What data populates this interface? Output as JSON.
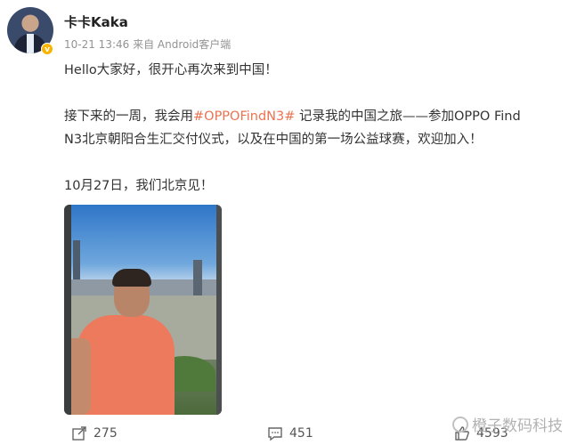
{
  "user": {
    "name": "卡卡Kaka",
    "verified_badge": "v",
    "timestamp": "10-21 13:46",
    "source": "来自 Android客户端"
  },
  "post": {
    "line1": "Hello大家好，很开心再次来到中国！",
    "line2_pre": "接下来的一周，我会用",
    "hashtag": "#OPPOFindN3#",
    "line2_post": " 记录我的中国之旅——参加OPPO Find",
    "line3": "N3北京朝阳合生汇交付仪式，以及在中国的第一场公益球赛，欢迎加入！",
    "line4": "10月27日，我们北京见！"
  },
  "colors": {
    "hashtag": "#eb7350",
    "meta": "#939393",
    "badge": "#f7b500"
  },
  "actions": {
    "repost_count": "275",
    "comment_count": "451",
    "like_count": "4593"
  },
  "watermark": {
    "text": "橙子数码科技"
  }
}
